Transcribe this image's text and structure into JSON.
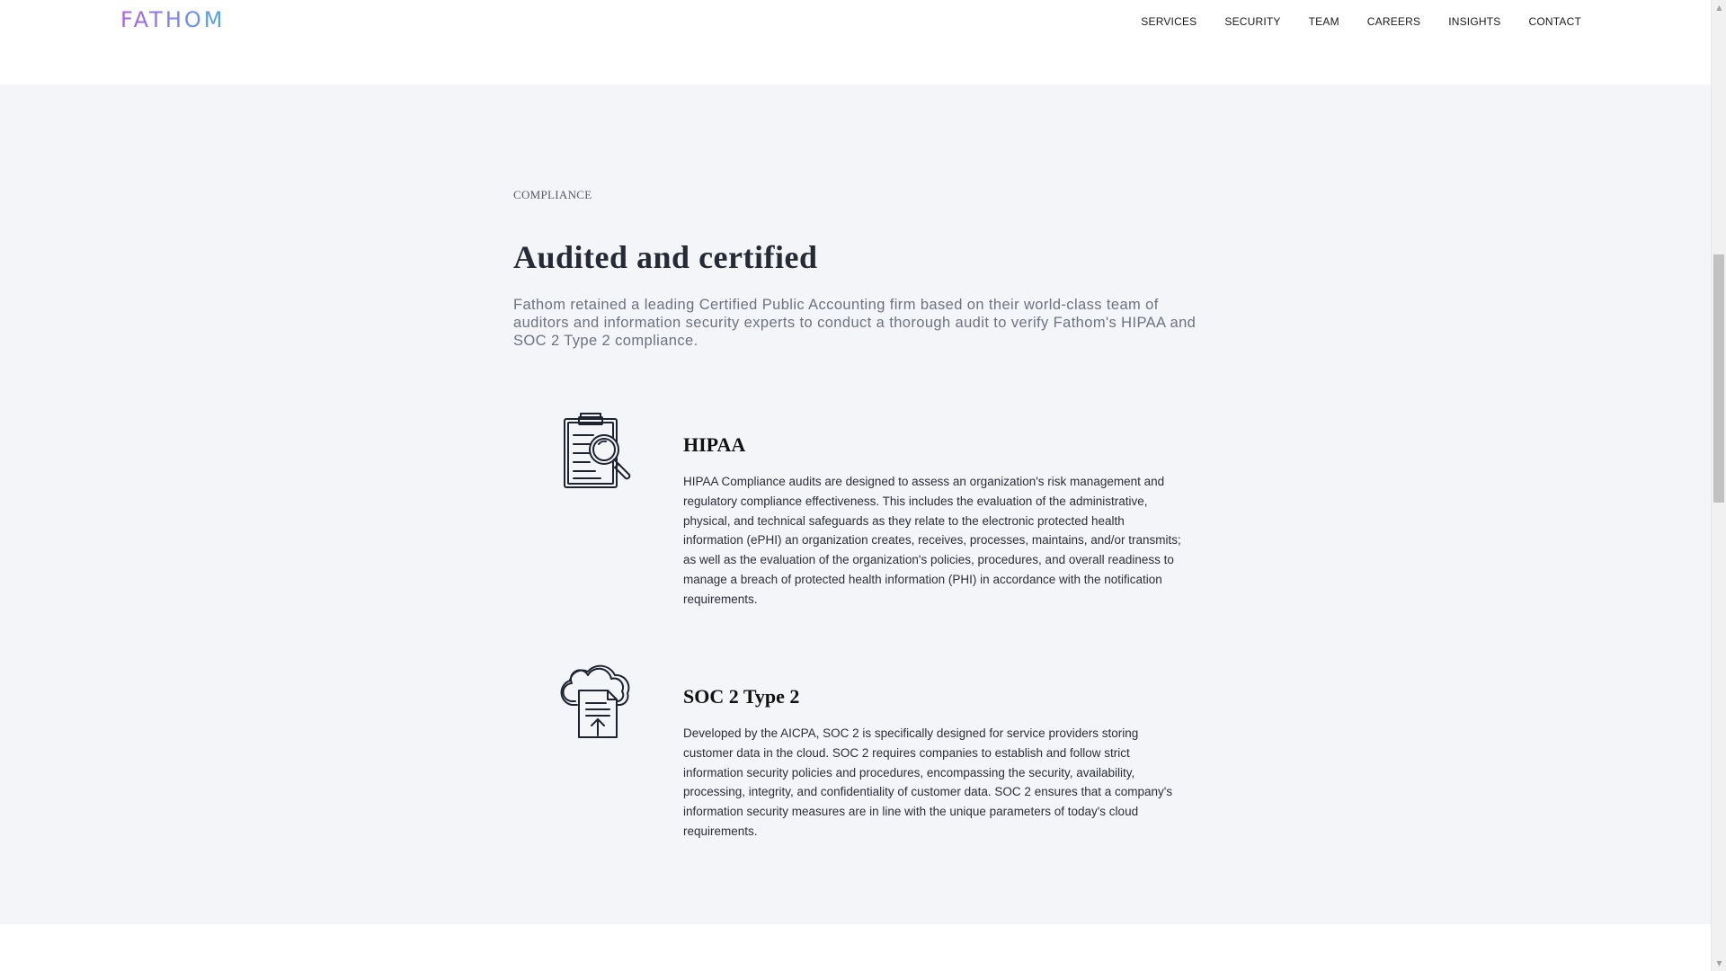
{
  "header": {
    "logo_text": "FATHOM",
    "nav": [
      {
        "label": "SERVICES"
      },
      {
        "label": "SECURITY"
      },
      {
        "label": "TEAM"
      },
      {
        "label": "CAREERS"
      },
      {
        "label": "INSIGHTS"
      },
      {
        "label": "CONTACT"
      }
    ]
  },
  "compliance": {
    "eyebrow": "COMPLIANCE",
    "title": "Audited and certified",
    "intro": "Fathom retained a leading Certified Public Accounting firm based on their world-class team of auditors and information security experts to conduct a thorough audit to verify Fathom's HIPAA and SOC 2 Type 2 compliance.",
    "features": [
      {
        "icon": "clipboard-search-icon",
        "title": "HIPAA",
        "body": "HIPAA Compliance audits are designed to assess an organization's risk management and regulatory compliance effectiveness. This includes the evaluation of the administrative, physical, and technical safeguards as they relate to the electronic protected health information (ePHI) an organization creates, receives, processes, maintains, and/or transmits; as well as the evaluation of the organization's policies, procedures, and overall readiness to manage a breach of protected health information (PHI) in accordance with the notification requirements."
      },
      {
        "icon": "cloud-upload-document-icon",
        "title": "SOC 2 Type 2",
        "body": "Developed by the AICPA, SOC 2 is specifically designed for service providers storing customer data in the cloud. SOC 2 requires companies to establish and follow strict information security policies and procedures, encompassing the security, availability, processing, integrity, and confidentiality of customer data. SOC 2 ensures that a company's information security measures are in line with the unique parameters of today's cloud requirements."
      }
    ]
  },
  "colors": {
    "section_bg": "#f4f5f9",
    "title": "#252a35",
    "intro": "#6d7280",
    "logo_gradient_start": "#b25fe0",
    "logo_gradient_end": "#4aa6e8"
  }
}
